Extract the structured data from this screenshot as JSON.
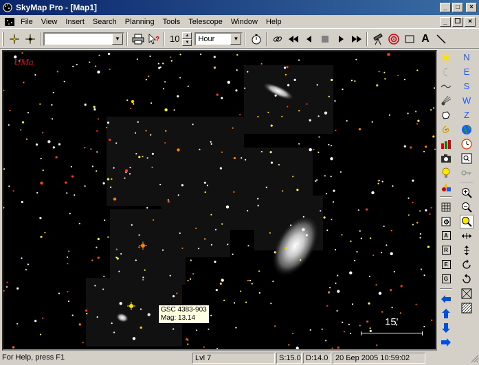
{
  "window": {
    "title": "SkyMap Pro - [Map1]",
    "minimize": "_",
    "maximize": "□",
    "close": "×",
    "mdi_minimize": "_",
    "mdi_restore": "❐",
    "mdi_close": "×"
  },
  "menu": [
    "File",
    "View",
    "Insert",
    "Search",
    "Planning",
    "Tools",
    "Telescope",
    "Window",
    "Help"
  ],
  "toolbar": {
    "search_value": "",
    "step_value": "10",
    "unit_value": "Hour"
  },
  "map": {
    "constellation_label": "UMa",
    "tooltip_line1": "GSC 4383-903",
    "tooltip_line2": "Mag: 13.14",
    "scale_label": "15'"
  },
  "side_right": {
    "compass": [
      "N",
      "E",
      "S",
      "W",
      "Z"
    ]
  },
  "side_small_letters": [
    "A",
    "R",
    "E",
    "G"
  ],
  "status": {
    "help": "For Help, press F1",
    "level": "Lvl 7",
    "scale": "S:15.0",
    "depth": "D:14.0",
    "datetime": "20 Бер 2005 10:59:02"
  },
  "colors": {
    "titlebar": "#0a246a",
    "sky": "#000000",
    "compass": "#1a5aff",
    "constellation": "#c0102a"
  }
}
